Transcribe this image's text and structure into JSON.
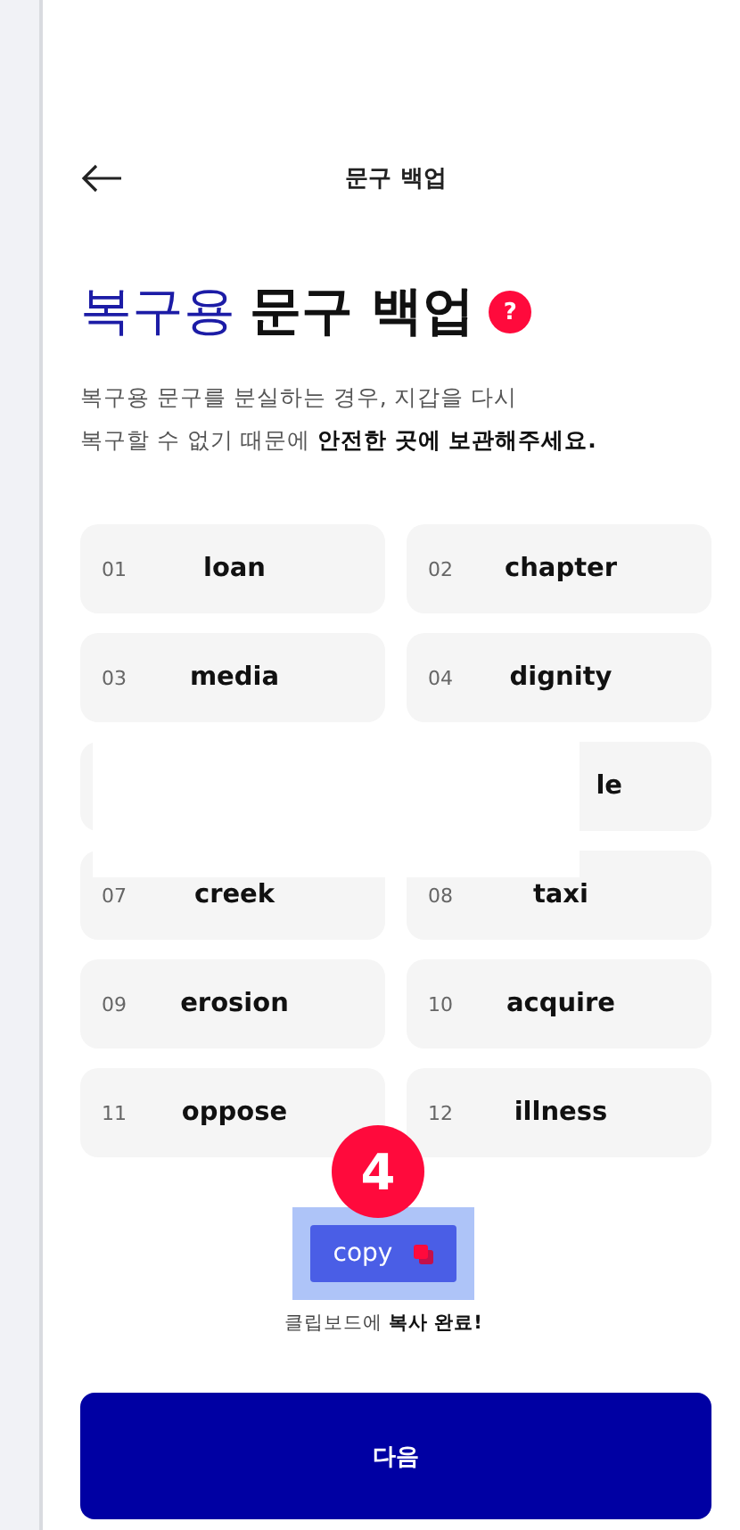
{
  "header": {
    "title": "문구 백업"
  },
  "heading": {
    "accent": "복구용",
    "rest": "문구 백업",
    "help_icon": "?"
  },
  "description": "복구용 문구를 분실하는 경우, 지갑을 다시\n복구할 수 없기 때문에 **안전한 곳에 보관해주세요.**",
  "words": [
    {
      "kind": "word",
      "number": "01",
      "word": "loan"
    },
    {
      "kind": "word",
      "number": "02",
      "word": "chapter"
    },
    {
      "kind": "word",
      "number": "03",
      "word": "media"
    },
    {
      "kind": "word",
      "number": "04",
      "word": "dignity"
    },
    {
      "kind": "masked"
    },
    {
      "kind": "masked",
      "word": "le"
    },
    {
      "kind": "word",
      "number": "07",
      "word": "creek"
    },
    {
      "kind": "word",
      "number": "08",
      "word": "taxi"
    },
    {
      "kind": "word",
      "number": "09",
      "word": "erosion"
    },
    {
      "kind": "word",
      "number": "10",
      "word": "acquire"
    },
    {
      "kind": "word",
      "number": "11",
      "word": "oppose"
    },
    {
      "kind": "word",
      "number": "12",
      "word": "illness"
    }
  ],
  "annotation_badge": "4",
  "copy_button": {
    "label": "copy"
  },
  "copy_notice": "클립보드에 **복사 완료!**",
  "next_button": "다음"
}
